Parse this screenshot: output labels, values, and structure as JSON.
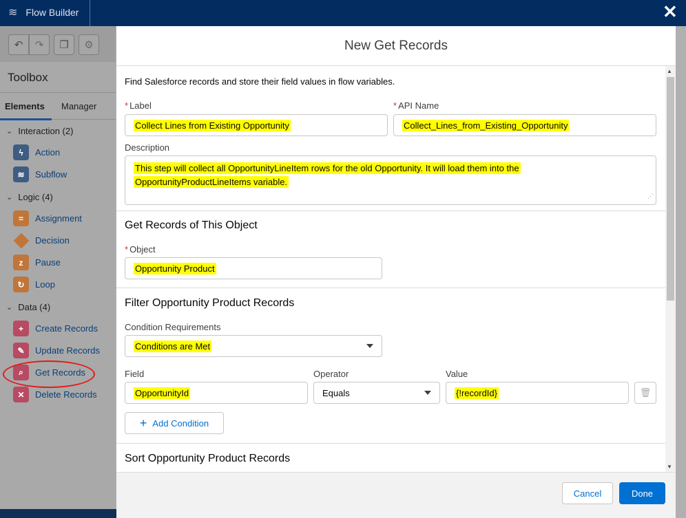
{
  "app": {
    "title": "Flow Builder"
  },
  "toolbox": {
    "title": "Toolbox",
    "tabs": [
      {
        "label": "Elements",
        "active": true
      },
      {
        "label": "Manager",
        "active": false
      }
    ],
    "groups": [
      {
        "label": "Interaction (2)",
        "items": [
          "Action",
          "Subflow"
        ]
      },
      {
        "label": "Logic (4)",
        "items": [
          "Assignment",
          "Decision",
          "Pause",
          "Loop"
        ]
      },
      {
        "label": "Data (4)",
        "items": [
          "Create Records",
          "Update Records",
          "Get Records",
          "Delete Records"
        ]
      }
    ]
  },
  "modal": {
    "title": "New Get Records",
    "intro": "Find Salesforce records and store their field values in flow variables.",
    "label_field": {
      "label": "Label",
      "value": "Collect Lines from Existing Opportunity"
    },
    "api_name_field": {
      "label": "API Name",
      "value": "Collect_Lines_from_Existing_Opportunity"
    },
    "description_field": {
      "label": "Description",
      "line1": "This step will collect all OpportunityLineItem rows for the old Opportunity.  It will load them into the",
      "line2": "OpportunityProductLineItems variable."
    },
    "object_section": {
      "title": "Get Records of This Object",
      "object_label": "Object",
      "object_value": "Opportunity Product"
    },
    "filter_section": {
      "title": "Filter Opportunity Product Records",
      "condition_label": "Condition Requirements",
      "condition_value": "Conditions are Met",
      "field_label": "Field",
      "operator_label": "Operator",
      "value_label": "Value",
      "field_value": "OpportunityId",
      "operator_value": "Equals",
      "value_value": "{!recordId}",
      "add_condition": "Add Condition"
    },
    "sort_section": {
      "title": "Sort Opportunity Product Records"
    },
    "footer": {
      "cancel": "Cancel",
      "done": "Done"
    }
  },
  "colors": {
    "brand": "#0070d2",
    "header": "#032d60",
    "highlight": "#ffff00",
    "annotation": "#e01b1b"
  }
}
